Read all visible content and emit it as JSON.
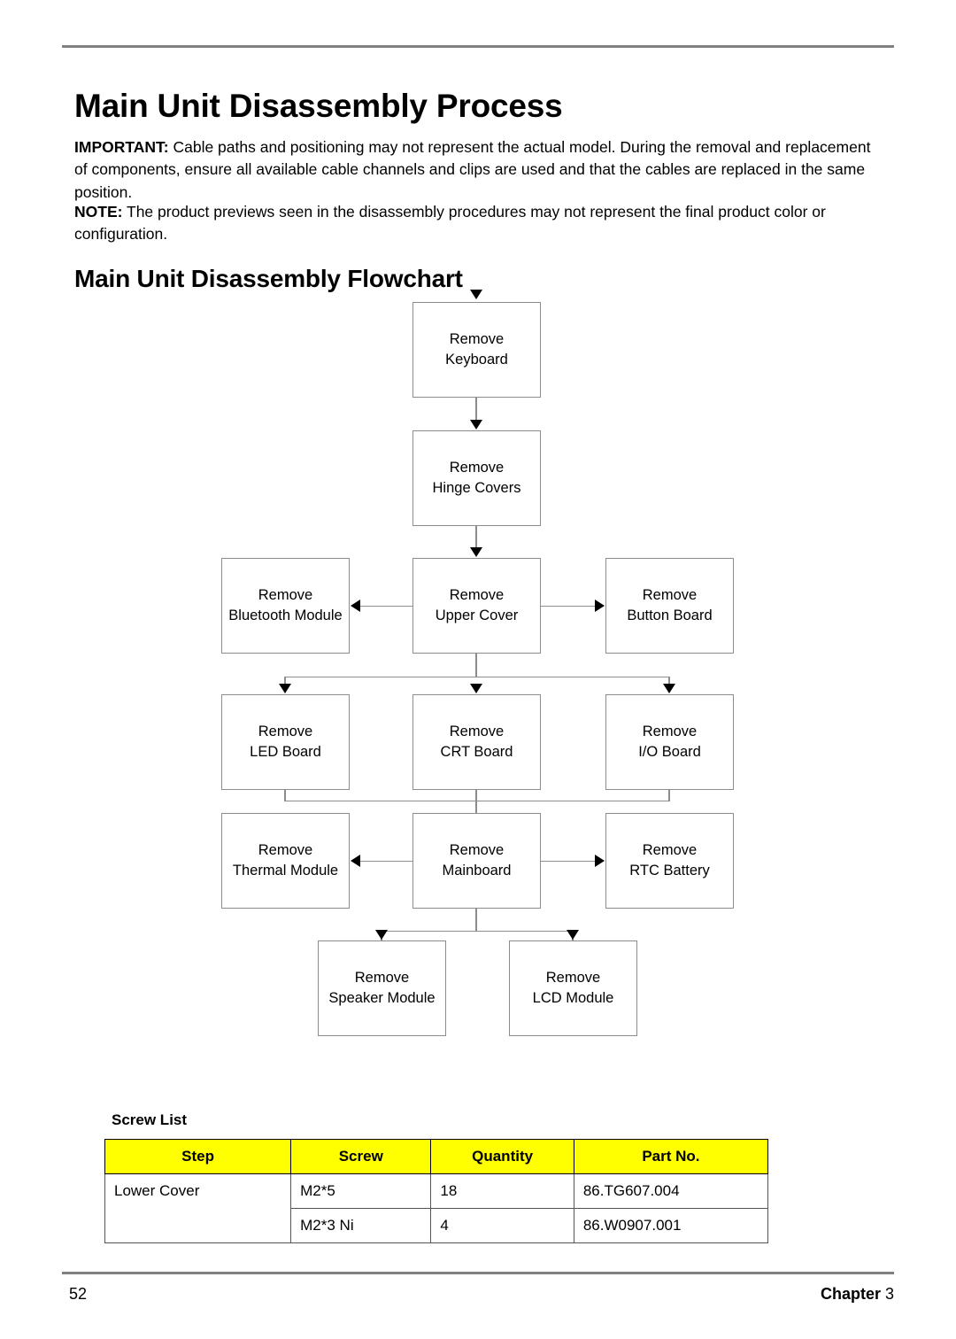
{
  "document": {
    "title": "Main Unit Disassembly Process",
    "section_title": "Main Unit Disassembly Flowchart",
    "notices": [
      {
        "label": "IMPORTANT:",
        "text": " Cable paths and positioning may not represent the actual model. During the removal and replacement of components, ensure all available cable channels and clips are used and that the cables are replaced in the same position."
      },
      {
        "label": "NOTE:",
        "text": " The product previews seen in the disassembly procedures may not represent the final product color or configuration."
      }
    ]
  },
  "flowchart": {
    "nodes": [
      {
        "id": "keyboard",
        "line1": "Remove",
        "line2": "Keyboard"
      },
      {
        "id": "hinge",
        "line1": "Remove",
        "line2": "Hinge Covers"
      },
      {
        "id": "bluetooth",
        "line1": "Remove",
        "line2": "Bluetooth Module"
      },
      {
        "id": "upper",
        "line1": "Remove",
        "line2": "Upper Cover"
      },
      {
        "id": "button",
        "line1": "Remove",
        "line2": "Button Board"
      },
      {
        "id": "led",
        "line1": "Remove",
        "line2": "LED Board"
      },
      {
        "id": "crt",
        "line1": "Remove",
        "line2": "CRT Board"
      },
      {
        "id": "io",
        "line1": "Remove",
        "line2": "I/O Board"
      },
      {
        "id": "thermal",
        "line1": "Remove",
        "line2": "Thermal Module"
      },
      {
        "id": "mainboard",
        "line1": "Remove",
        "line2": "Mainboard"
      },
      {
        "id": "rtc",
        "line1": "Remove",
        "line2": "RTC Battery"
      },
      {
        "id": "speaker",
        "line1": "Remove",
        "line2": "Speaker Module"
      },
      {
        "id": "lcd",
        "line1": "Remove",
        "line2": "LCD Module"
      }
    ]
  },
  "screw_list": {
    "title": "Screw List",
    "headers": [
      "Step",
      "Screw",
      "Quantity",
      "Part No."
    ],
    "rows": [
      {
        "step": "Lower Cover",
        "screw": "M2*5",
        "quantity": "18",
        "part_no": "86.TG607.004"
      },
      {
        "step": "",
        "screw": "M2*3 Ni",
        "quantity": "4",
        "part_no": "86.W0907.001"
      }
    ]
  },
  "footer": {
    "page_number": "52",
    "chapter_label": "Chapter",
    "chapter_number": "3"
  },
  "colors": {
    "header_highlight": "#ffff00",
    "rule": "#808080",
    "box_border": "#8c8c8c"
  }
}
